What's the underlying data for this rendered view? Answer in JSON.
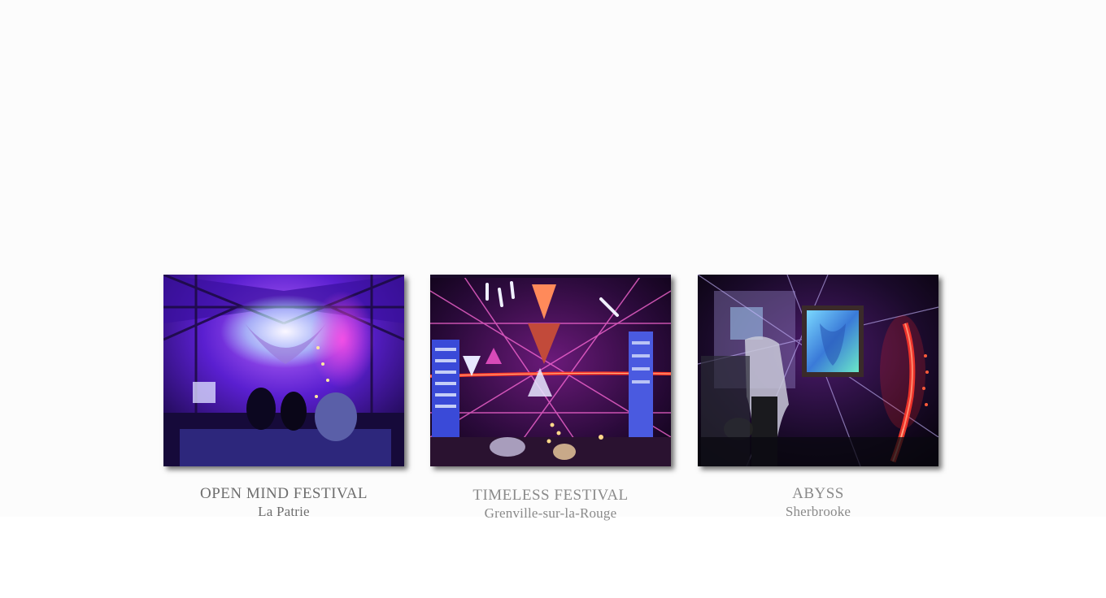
{
  "gallery": {
    "items": [
      {
        "title": "OPEN MIND FESTIVAL",
        "place": "La Patrie"
      },
      {
        "title": "TIMELESS FESTIVAL",
        "place": "Grenville-sur-la-Rouge"
      },
      {
        "title": "ABYSS",
        "place": "Sherbrooke"
      }
    ]
  },
  "colors": {
    "background": "#fcfcfc",
    "caption_text": "#6e6e6e",
    "uv_purple": "#6a1fd8",
    "neon_magenta": "#e61ad6",
    "neon_red": "#ff3a2a"
  }
}
